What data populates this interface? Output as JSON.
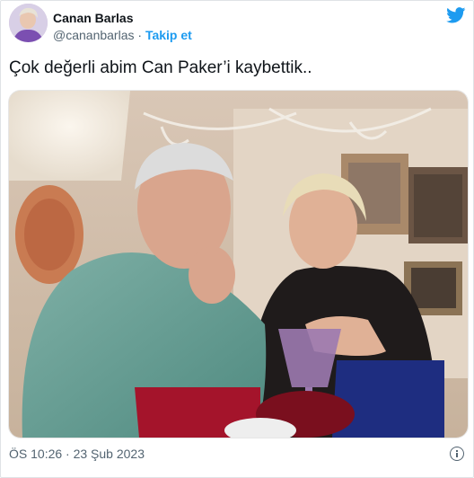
{
  "tweet": {
    "author_name": "Canan Barlas",
    "author_handle": "@cananbarlas",
    "separator": "·",
    "follow_label": "Takip et",
    "text": "Çok değerli abim Can Paker’i kaybettik..",
    "timestamp": "ÖS 10:26 · 23 Şub 2023"
  },
  "icons": {
    "brand": "twitter-bird-icon",
    "info": "info-icon"
  },
  "colors": {
    "accent": "#1d9bf0",
    "text": "#0f1419",
    "muted": "#536471"
  }
}
